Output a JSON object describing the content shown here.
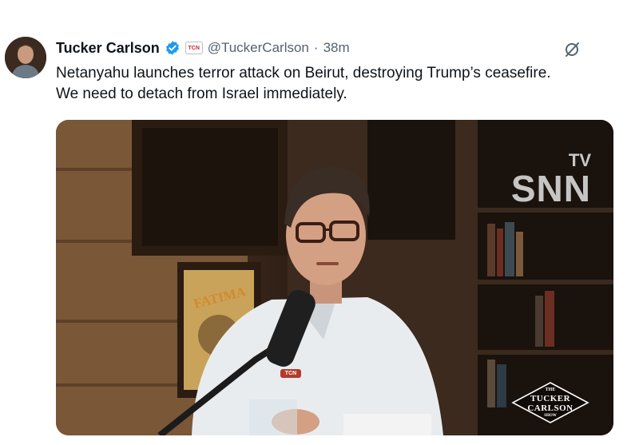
{
  "tweet": {
    "author_name": "Tucker Carlson",
    "affiliation_badge": "TCN",
    "handle": "@TuckerCarlson",
    "separator": "·",
    "time": "38m",
    "text_line1": "Netanyahu launches terror attack on Beirut, destroying Trump’s ceasefire.",
    "text_line2": "We need to detach from Israel immediately.",
    "verified_color": "#1d9bf0"
  },
  "media": {
    "watermark_tv": "TV",
    "watermark_snn": "SNN",
    "poster_text": "FATIMA",
    "mic_badge": "TCN",
    "show_logo": {
      "line1": "THE",
      "line2": "TUCKER",
      "line3": "CARLSON",
      "line4": "SHOW"
    }
  },
  "icons": {
    "verified": "verified-badge-icon",
    "more": "grok-icon"
  }
}
